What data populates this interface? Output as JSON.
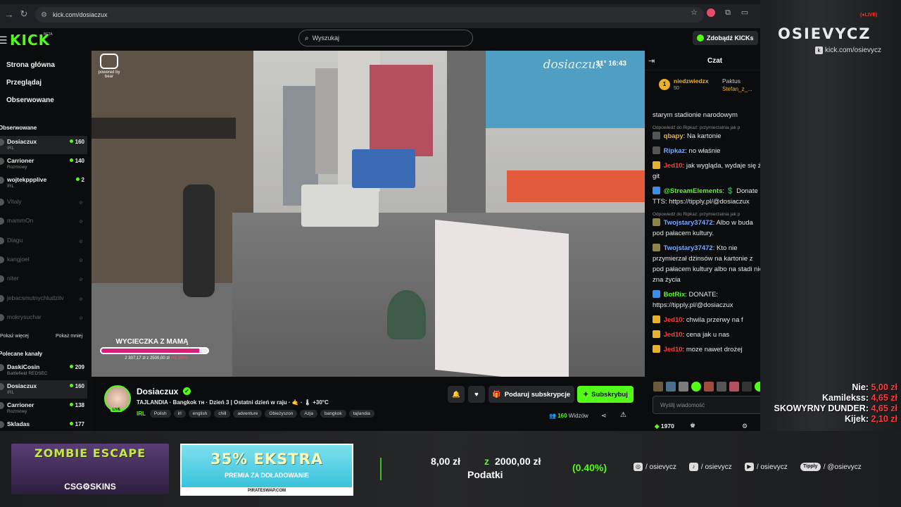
{
  "browser": {
    "url": "kick.com/dosiaczux"
  },
  "kick": {
    "logo": "KICK",
    "beta": "BETA",
    "search_placeholder": "Wyszukaj",
    "get_kicks": "Zdobądź KICKs"
  },
  "sidebar": {
    "nav": [
      "Strona główna",
      "Przeglądaj",
      "Obserwowane"
    ],
    "followed_title": "Obserwowane",
    "followed": [
      {
        "name": "Dosiaczux",
        "category": "IRL",
        "viewers": "160",
        "active": true,
        "online": true
      },
      {
        "name": "Carrioner",
        "category": "Rozmowy",
        "viewers": "140",
        "online": true
      },
      {
        "name": "wojtekppplive",
        "category": "IRL",
        "viewers": "2",
        "online": true
      },
      {
        "name": "Vitaly",
        "online": false
      },
      {
        "name": "mammOn",
        "online": false
      },
      {
        "name": "Diagu",
        "online": false
      },
      {
        "name": "kangjoel",
        "online": false
      },
      {
        "name": "niter",
        "online": false
      },
      {
        "name": "jebacsmutnychludzitv",
        "online": false
      },
      {
        "name": "mokrysuchar",
        "online": false
      }
    ],
    "show_more": "Pokaż więcej",
    "show_less": "Pokaż mniej",
    "recommended_title": "Polecane kanały",
    "recommended": [
      {
        "name": "DaskiCosin",
        "category": "Battlefield REDSEC",
        "viewers": "209"
      },
      {
        "name": "Dosiaczux",
        "category": "IRL",
        "viewers": "160",
        "active": true
      },
      {
        "name": "Carrioner",
        "category": "Rozmowy",
        "viewers": "138"
      },
      {
        "name": "Skladas",
        "category": "",
        "viewers": "177"
      }
    ]
  },
  "video": {
    "watermark": "dosiaczux",
    "temperature_time": "31° 16:43",
    "bear_label": "powered by bear",
    "goal_title": "WYCIECZKA Z MAMĄ",
    "goal_amount": "2 307,17 zł z 2500,00 zł",
    "goal_percent": "(92,29%)",
    "goal_progress": 0.9229
  },
  "stream": {
    "name": "Dosiaczux",
    "live_label": "LIVE",
    "title": "TAJLANDIA · Bangkok ᴛʜ · Dzień 3 | Ostatni dzień w raju · 🤙 · 🌡 +30°C",
    "category": "IRL",
    "tags": [
      "Polish",
      "irl",
      "english",
      "chill",
      "adventure",
      "Obieżyszon",
      "Azja",
      "bangkok",
      "tajlandia"
    ],
    "gift_subs": "Podaruj subskrypcje",
    "subscribe": "Subskrybuj",
    "viewers": "160",
    "viewers_label": "Widzów"
  },
  "chat": {
    "title": "Czat",
    "pinned": {
      "rank": "1",
      "user1": "niedzwiedzx",
      "value1": "50",
      "user2": "Paktus",
      "user3": "Stefan_z_..."
    },
    "messages": [
      {
        "type": "text",
        "text": "starym stadionie narodowym"
      },
      {
        "type": "reply",
        "text": "Odpowiedź do Ripkaz: przymierzalnia jak p"
      },
      {
        "type": "msg",
        "user": "qbapy",
        "color": "#e8b12a",
        "text": "Na kartonie"
      },
      {
        "type": "msg",
        "user": "Ripkaz",
        "color": "#7aa9ff",
        "text": "no właśnie"
      },
      {
        "type": "msg",
        "user": "Jed10",
        "color": "#ff3b3b",
        "text": "jak wygląda, wydaje się że git"
      },
      {
        "type": "msg",
        "user": "@StreamElements",
        "color": "#53fc18",
        "text": "💲 Donate TTS: https://tipply.pl/@dosiaczux"
      },
      {
        "type": "reply",
        "text": "Odpowiedź do Ripkaz: przymierzalnia jak p"
      },
      {
        "type": "msg",
        "user": "Twojstary37472",
        "color": "#7aa9ff",
        "text": "Albo w buda pod pałacem kultury."
      },
      {
        "type": "msg",
        "user": "Twojstary37472",
        "color": "#7aa9ff",
        "text": "Kto nie przymierzał dżinsów na kartonie z pod pałacem kultury albo na stadi nie zna życia"
      },
      {
        "type": "msg",
        "user": "BotRix",
        "color": "#53fc18",
        "text": "DONATE: https://tipply.pl/@dosiaczux"
      },
      {
        "type": "msg",
        "user": "Jed10",
        "color": "#ff3b3b",
        "text": "chwila przerwy na f"
      },
      {
        "type": "msg",
        "user": "Jed10",
        "color": "#ff3b3b",
        "text": "cena jak u nas"
      },
      {
        "type": "msg",
        "user": "Jed10",
        "color": "#ff3b3b",
        "text": "moze nawet drożej"
      }
    ],
    "input_placeholder": "Wyślij wiadomość",
    "kicks_count": "1970"
  },
  "overlay": {
    "live": "(●LIVE)",
    "brand": "OSIEVYCZ",
    "url": "kick.com/osievycz",
    "donors": [
      {
        "name": "Nie:",
        "amount": "5,00 zł"
      },
      {
        "name": "Kamilekss:",
        "amount": "4,65 zł"
      },
      {
        "name": "SKOWYRNY DUNDER:",
        "amount": "4,65 zł"
      },
      {
        "name": "Kijek:",
        "amount": "2,10 zł"
      }
    ],
    "ad1_title": "ZOMBIE ESCAPE",
    "ad1_brand": "CSG⚙SKINS",
    "ad2_title": "35% EKSTRA",
    "ad2_sub": "PREMIA ZA DOŁADOWANIE",
    "ad2_foot": "PIRATESWAP.COM",
    "tax_amount": "8,00 zł",
    "tax_z": "z",
    "tax_goal": "2000,00 zł",
    "tax_label": "Podatki",
    "tax_percent": "(0.40%)",
    "socials": [
      {
        "icon": "instagram-icon",
        "glyph": "◎",
        "handle": "/ osievycz"
      },
      {
        "icon": "tiktok-icon",
        "glyph": "♪",
        "handle": "/ osievycz"
      },
      {
        "icon": "youtube-icon",
        "glyph": "▶",
        "handle": "/ osievycz"
      },
      {
        "icon": "tipply-icon",
        "glyph": "Tipply",
        "handle": "/ @osievycz"
      }
    ]
  }
}
